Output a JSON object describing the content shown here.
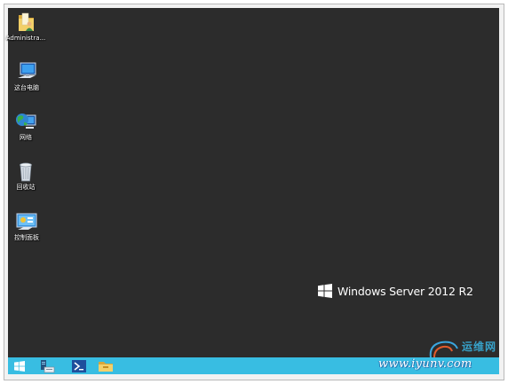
{
  "desktop_icons": [
    {
      "icon": "folder-user-icon",
      "label": "Administra..."
    },
    {
      "icon": "computer-icon",
      "label": "这台电脑"
    },
    {
      "icon": "network-icon",
      "label": "网络"
    },
    {
      "icon": "recycle-bin-icon",
      "label": "回收站"
    },
    {
      "icon": "control-panel-icon",
      "label": "控制面板"
    }
  ],
  "branding": {
    "logo": "windows-logo-icon",
    "text": "Windows Server 2012 R2"
  },
  "taskbar": {
    "buttons": [
      {
        "icon": "start-windows-icon"
      },
      {
        "icon": "server-manager-icon"
      },
      {
        "icon": "powershell-icon"
      },
      {
        "icon": "file-explorer-icon"
      }
    ]
  },
  "watermark": {
    "site_name": "运维网",
    "url": "www.iyunv.com"
  },
  "colors": {
    "desktop_bg": "#2c2c2c",
    "taskbar_bg": "#38bde2",
    "label_text": "#ffffff"
  }
}
